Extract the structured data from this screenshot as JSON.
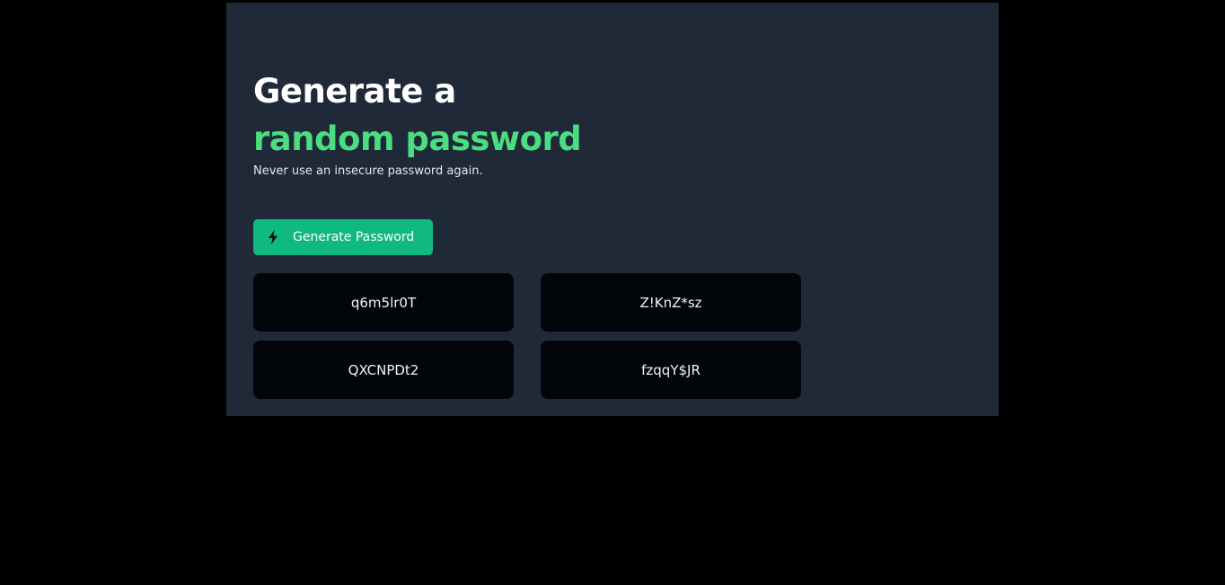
{
  "header": {
    "title_line1": "Generate a",
    "title_line2": "random password",
    "subtitle": "Never use an insecure password again."
  },
  "generate_button": {
    "label": "Generate Password",
    "icon": "lightning-bolt-icon"
  },
  "passwords": [
    "q6m5lr0T",
    "Z!KnZ*sz",
    "QXCNPDt2",
    "fzqqY$JR"
  ],
  "colors": {
    "page_background": "#000000",
    "card_background": "#1f2937",
    "accent_text": "#4ade80",
    "button": "#10b981",
    "password_box": "#020509"
  }
}
